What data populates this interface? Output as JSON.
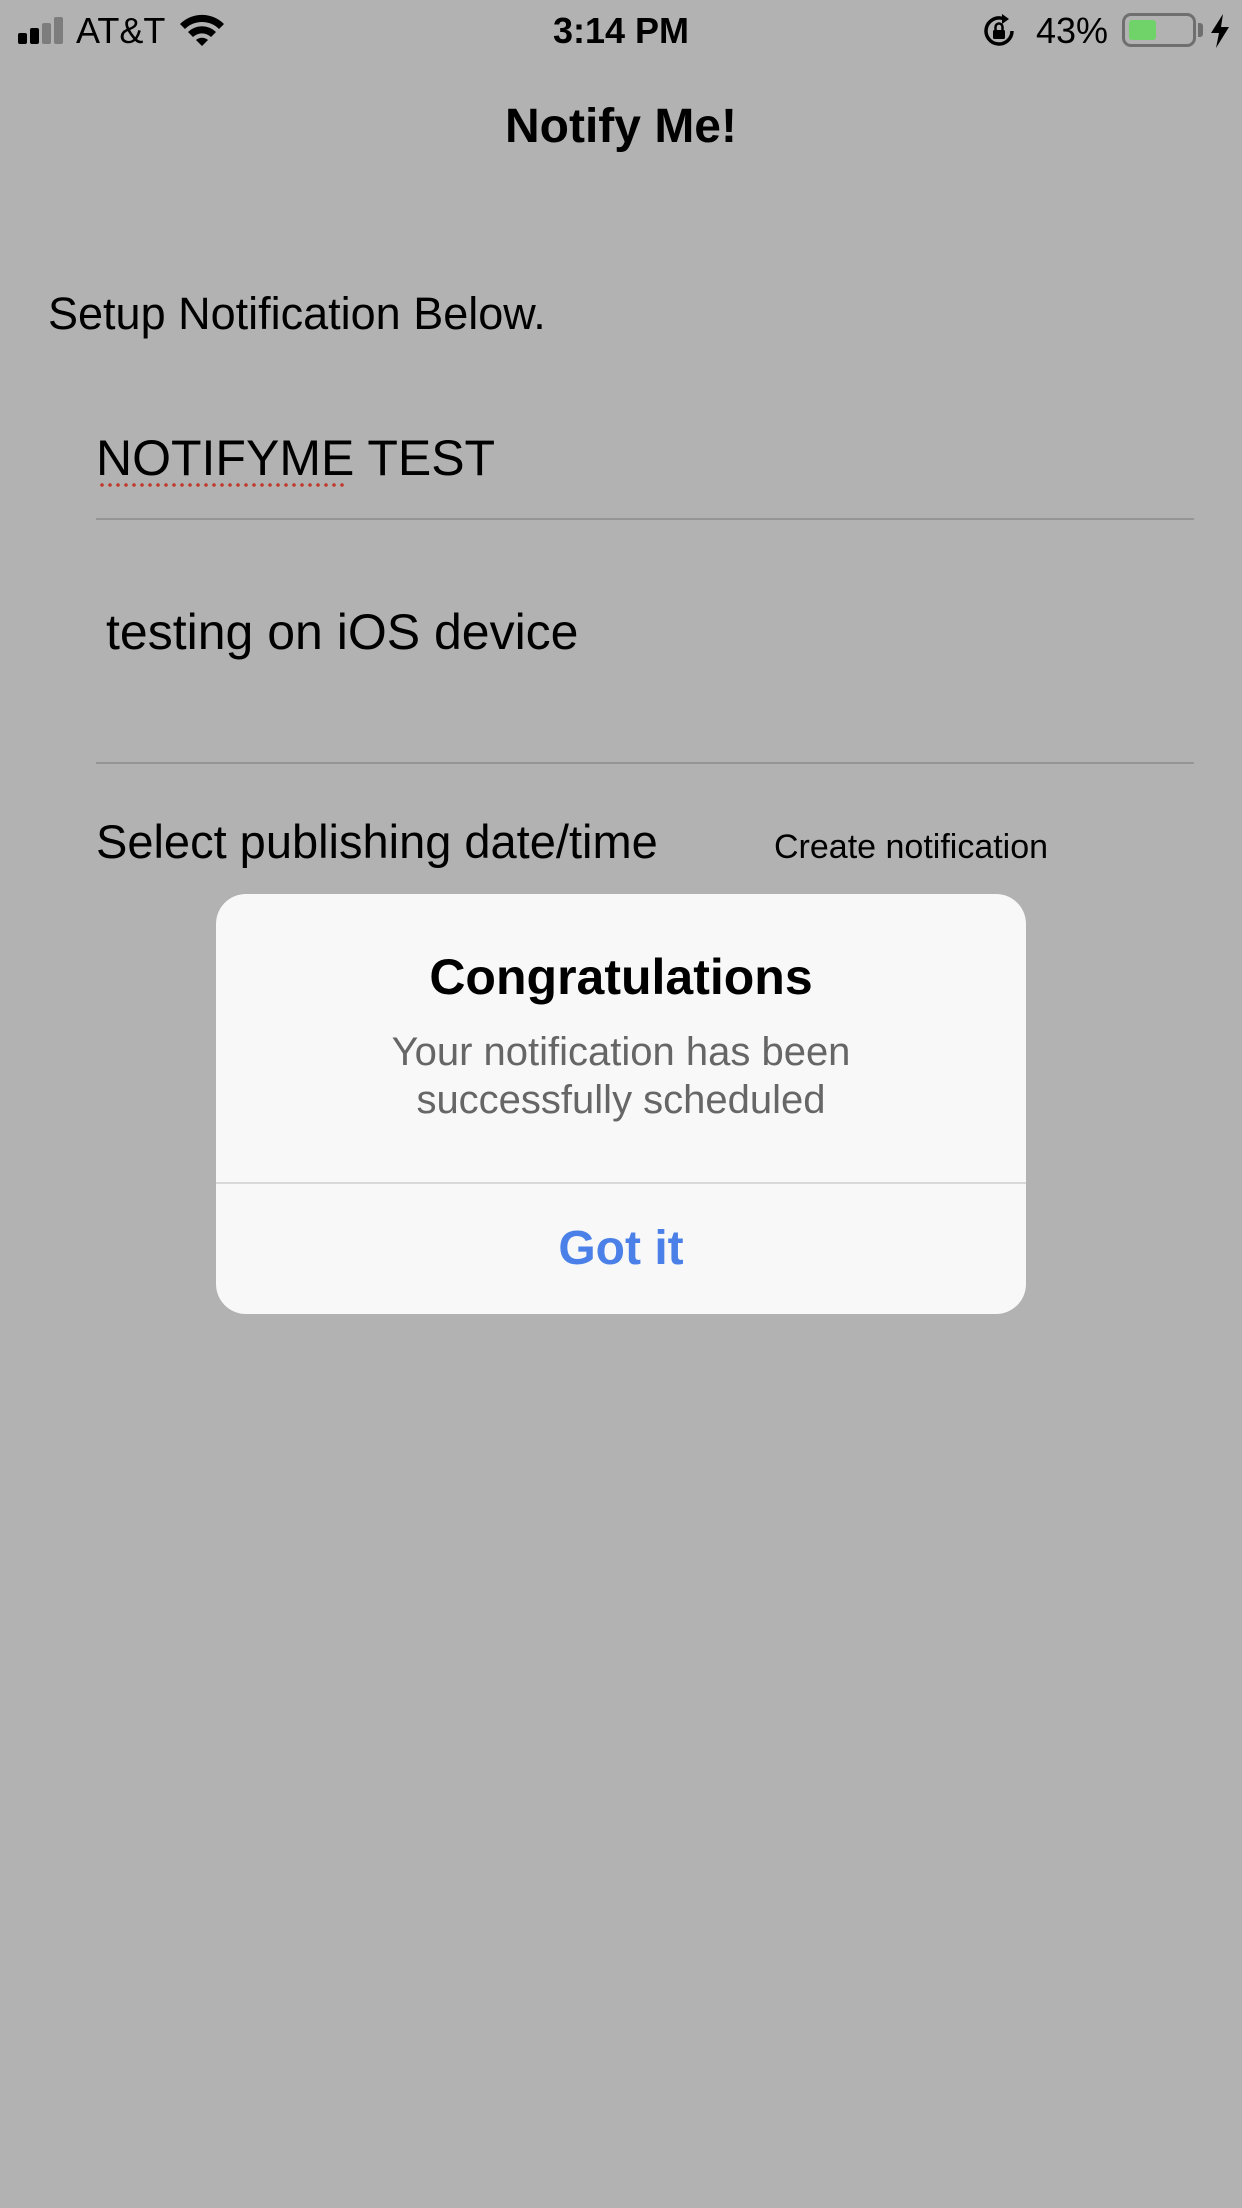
{
  "status_bar": {
    "carrier": "AT&T",
    "time": "3:14 PM",
    "battery_percent": "43%",
    "battery_level": 0.43,
    "signal_bars": 2,
    "signal_bars_total": 4,
    "icons": [
      "signal-icon",
      "wifi-icon",
      "rotation-lock-icon",
      "battery-icon",
      "charging-icon"
    ],
    "battery_color": "#6fd36a"
  },
  "nav": {
    "title": "Notify Me!"
  },
  "form": {
    "setup_label": "Setup Notification Below.",
    "title_value": "NOTIFYME TEST",
    "message_value": "testing on iOS device",
    "date_label": "Select publishing date/time",
    "create_button": "Create notification"
  },
  "alert": {
    "title": "Congratulations",
    "message_line1": "Your notification has been",
    "message_line2": "successfully scheduled",
    "button": "Got it",
    "button_color": "#4a80e7"
  }
}
